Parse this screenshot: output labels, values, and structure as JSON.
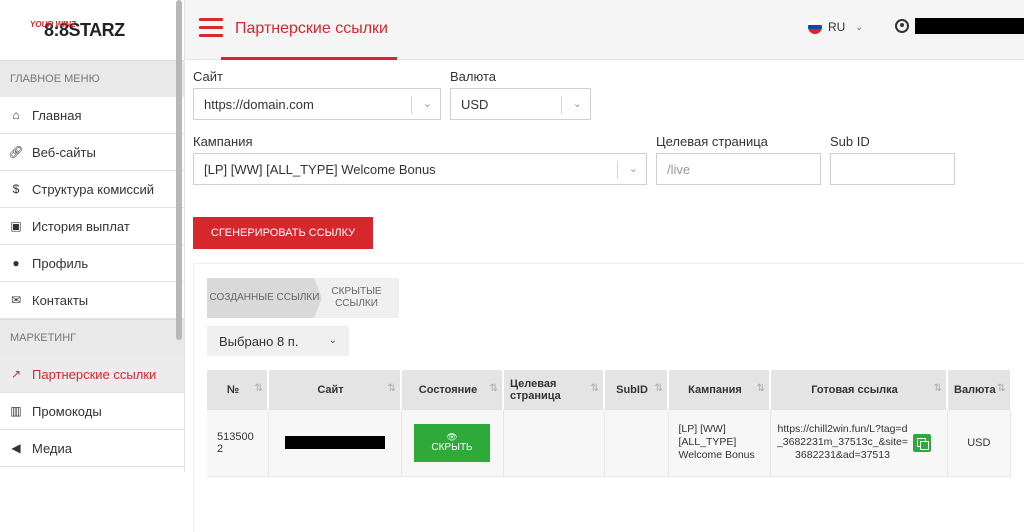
{
  "brand": {
    "logo_text": "8:8STARZ",
    "logo_tagline": "YOUR WINZ"
  },
  "colors": {
    "accent": "#d8262d",
    "success": "#2eaa3a",
    "sidebar_section_bg": "#e9e9e9",
    "table_header_bg": "#e4e4e4"
  },
  "sidebar": {
    "section_main": "ГЛАВНОЕ МЕНЮ",
    "main_items": [
      {
        "label": "Главная",
        "icon": "home-icon"
      },
      {
        "label": "Веб-сайты",
        "icon": "link-icon"
      },
      {
        "label": "Структура комиссий",
        "icon": "dollar-icon"
      },
      {
        "label": "История выплат",
        "icon": "money-icon"
      },
      {
        "label": "Профиль",
        "icon": "user-icon"
      },
      {
        "label": "Контакты",
        "icon": "envelope-icon"
      }
    ],
    "section_marketing": "МАРКЕТИНГ",
    "marketing_items": [
      {
        "label": "Партнерские ссылки",
        "icon": "external-link-icon",
        "active": true
      },
      {
        "label": "Промокоды",
        "icon": "barcode-icon"
      },
      {
        "label": "Медиа",
        "icon": "megaphone-icon"
      }
    ]
  },
  "header": {
    "title": "Партнерские ссылки",
    "language": "RU"
  },
  "form": {
    "site_label": "Сайт",
    "site_value": "https://domain.com",
    "currency_label": "Валюта",
    "currency_value": "USD",
    "campaign_label": "Кампания",
    "campaign_value": "[LP] [WW] [ALL_TYPE] Welcome Bonus",
    "landing_label": "Целевая страница",
    "landing_placeholder": "/live",
    "subid_label": "Sub ID",
    "subid_value": "",
    "generate_label": "СГЕНЕРИРОВАТЬ ССЫЛКУ"
  },
  "links_panel": {
    "tab_created": "СОЗДАННЫЕ ССЫЛКИ",
    "tab_hidden": "СКРЫТЫЕ ССЫЛКИ",
    "selected_label": "Выбрано 8 п.",
    "columns": [
      "№",
      "Сайт",
      "Состояние",
      "Целевая страница",
      "SubID",
      "Кампания",
      "Готовая ссылка",
      "Валюта"
    ],
    "rows": [
      {
        "id": "5135002",
        "state_button": "СКРЫТЬ",
        "landing": "",
        "subid": "",
        "campaign": "[LP] [WW] [ALL_TYPE] Welcome Bonus",
        "link": "https://chill2win.fun/L?tag=d_3682231m_37513c_&site=3682231&ad=37513",
        "currency": "USD"
      }
    ]
  }
}
